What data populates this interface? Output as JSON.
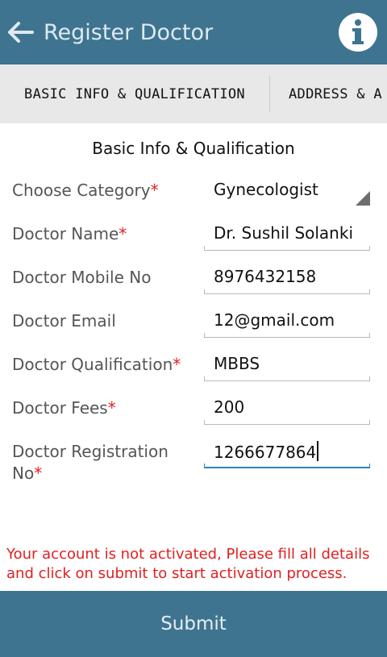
{
  "appbar": {
    "title": "Register Doctor",
    "back_icon": "arrow-left-icon",
    "info_icon": "info-icon",
    "color": "#3e7490"
  },
  "tabs": [
    {
      "label": "BASIC INFO & QUALIFICATION",
      "selected": true
    },
    {
      "label": "ADDRESS & A",
      "selected": false
    }
  ],
  "section_title": "Basic Info & Qualification",
  "form": {
    "category": {
      "label": "Choose Category",
      "required": "*",
      "value": "Gynecologist"
    },
    "name": {
      "label": "Doctor Name",
      "required": "*",
      "value": "Dr. Sushil Solanki"
    },
    "mobile": {
      "label": "Doctor Mobile No",
      "value": "8976432158"
    },
    "email": {
      "label": "Doctor Email",
      "value": "12@gmail.com"
    },
    "qualification": {
      "label": "Doctor Qualification",
      "required": "*",
      "value": "MBBS"
    },
    "fees": {
      "label": "Doctor Fees",
      "required": "*",
      "value": "200"
    },
    "registration": {
      "label_line1": "Doctor Registration",
      "label_line2": "No",
      "required": "*",
      "value": "1266677864"
    }
  },
  "warning": "Your account is not activated, Please fill all details and click on submit to start activation process.",
  "submit_label": "Submit",
  "colors": {
    "accent": "#3e7490",
    "error": "#e02020",
    "focus": "#2f82b9"
  }
}
